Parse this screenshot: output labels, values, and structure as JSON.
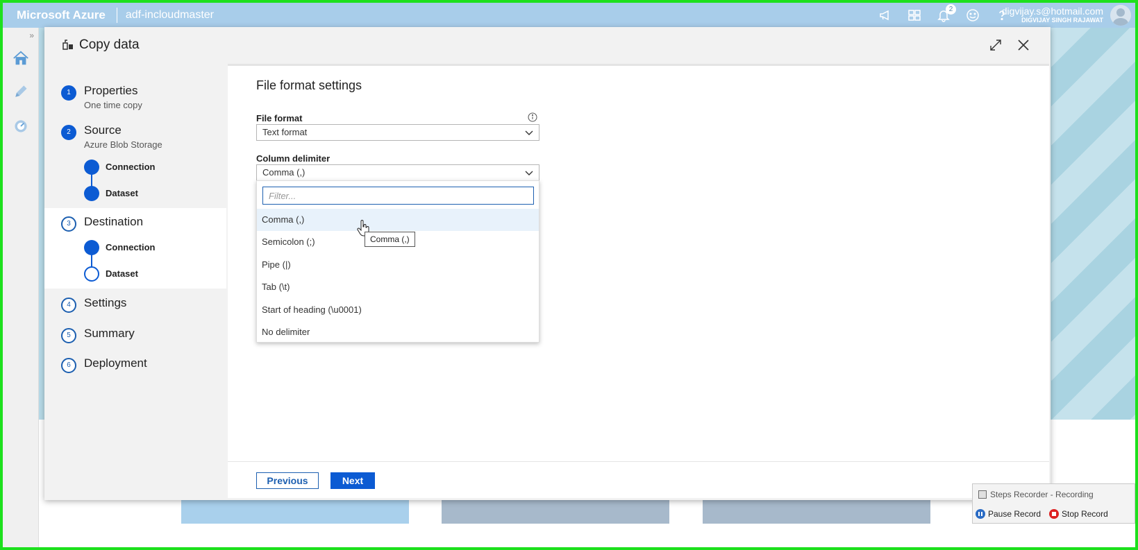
{
  "topbar": {
    "brand": "Microsoft Azure",
    "factory_name": "adf-incloudmaster",
    "notification_count": "2",
    "account_email": "digvijay.s@hotmail.com",
    "account_name": "DIGVIJAY SINGH RAJAWAT",
    "icons": [
      "megaphone-icon",
      "directory-icon",
      "bell-icon",
      "smiley-icon",
      "help-icon"
    ]
  },
  "rail": {
    "expand_label": "»",
    "icons": [
      "home-icon",
      "pencil-icon",
      "monitor-icon"
    ]
  },
  "dialog": {
    "title": "Copy data",
    "steps": [
      {
        "number": "1",
        "label": "Properties",
        "sub": "One time copy",
        "state": "done"
      },
      {
        "number": "2",
        "label": "Source",
        "sub": "Azure Blob Storage",
        "state": "done",
        "substeps": [
          {
            "label": "Connection",
            "state": "done"
          },
          {
            "label": "Dataset",
            "state": "done"
          }
        ]
      },
      {
        "number": "3",
        "label": "Destination",
        "sub": "",
        "state": "current",
        "substeps": [
          {
            "label": "Connection",
            "state": "done"
          },
          {
            "label": "Dataset",
            "state": "current"
          }
        ]
      },
      {
        "number": "4",
        "label": "Settings",
        "state": "todo"
      },
      {
        "number": "5",
        "label": "Summary",
        "state": "todo"
      },
      {
        "number": "6",
        "label": "Deployment",
        "state": "todo"
      }
    ]
  },
  "panel": {
    "heading": "File format settings",
    "file_format_label": "File format",
    "file_format_value": "Text format",
    "column_delimiter_label": "Column delimiter",
    "column_delimiter_value": "Comma (,)",
    "filter_placeholder": "Filter...",
    "options": [
      "Comma (,)",
      "Semicolon (;)",
      "Pipe (|)",
      "Tab (\\t)",
      "Start of heading (\\u0001)",
      "No delimiter"
    ],
    "hovered_option": "Comma (,)",
    "tooltip": "Comma (,)",
    "previous_label": "Previous",
    "next_label": "Next"
  },
  "recorder": {
    "title": "Steps Recorder - Recording",
    "pause_label": "Pause Record",
    "stop_label": "Stop Record"
  },
  "colors": {
    "accent": "#0c5bd3",
    "azure_bar": "#a8cdea",
    "frame_border": "#1de01d"
  }
}
